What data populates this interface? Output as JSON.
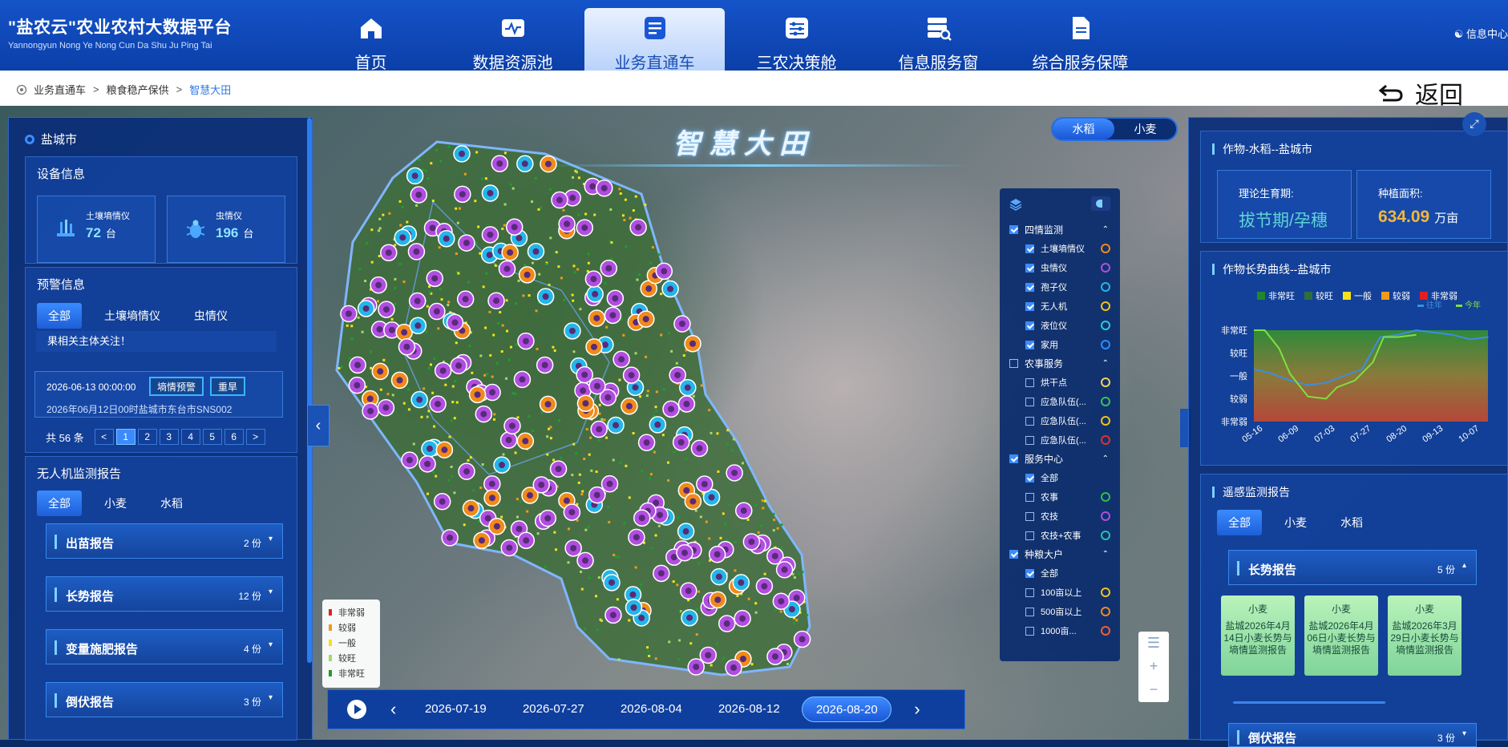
{
  "app": {
    "title": "\"盐农云\"农业农村大数据平台",
    "subtitle": "Yannongyun Nong Ye Nong Cun Da Shu Ju Ping Tai",
    "user_link": "信息中心"
  },
  "nav": [
    {
      "label": "首页",
      "icon": "home-icon",
      "active": false
    },
    {
      "label": "数据资源池",
      "icon": "pulse-chart-icon",
      "active": false
    },
    {
      "label": "业务直通车",
      "icon": "document-list-icon",
      "active": true
    },
    {
      "label": "三农决策舱",
      "icon": "sliders-icon",
      "active": false
    },
    {
      "label": "信息服务窗",
      "icon": "server-search-icon",
      "active": false
    },
    {
      "label": "综合服务保障",
      "icon": "file-icon",
      "active": false
    }
  ],
  "breadcrumb": [
    "业务直通车",
    "粮食稳产保供",
    "智慧大田"
  ],
  "back_label": "返回",
  "map": {
    "title": "智慧大田",
    "crop_toggle": [
      "水稻",
      "小麦"
    ],
    "legend": [
      {
        "label": "非常弱",
        "color": "#e02020"
      },
      {
        "label": "较弱",
        "color": "#f09a1c"
      },
      {
        "label": "一般",
        "color": "#f5e21a"
      },
      {
        "label": "较旺",
        "color": "#a7d86a"
      },
      {
        "label": "非常旺",
        "color": "#1e9e2c"
      }
    ],
    "timeline": [
      "2026-07-19",
      "2026-07-27",
      "2026-08-04",
      "2026-08-12",
      "2026-08-20"
    ],
    "timeline_active": 4
  },
  "left": {
    "city": "盐城市",
    "device_title": "设备信息",
    "devices": [
      {
        "name": "土壤墒情仪",
        "count": "72",
        "unit": "台",
        "icon": "soil-sensor-icon"
      },
      {
        "name": "虫情仪",
        "count": "196",
        "unit": "台",
        "icon": "bug-icon"
      }
    ],
    "warning_title": "预警信息",
    "warning_tabs": [
      "全部",
      "土壤墒情仪",
      "虫情仪"
    ],
    "warning_text": "果相关主体关注！",
    "warning_item": {
      "time": "2026-06-13 00:00:00",
      "tag1": "墒情预警",
      "tag2": "重旱",
      "sub": "2026年06月12日00时盐城市东台市SNS002"
    },
    "pager": {
      "total_label": "共 56 条",
      "pages": [
        "1",
        "2",
        "3",
        "4",
        "5",
        "6"
      ],
      "current": "1"
    },
    "drone_title": "无人机监测报告",
    "drone_tabs": [
      "全部",
      "小麦",
      "水稻"
    ],
    "reports": [
      {
        "title": "出苗报告",
        "count": "2 份"
      },
      {
        "title": "长势报告",
        "count": "12 份"
      },
      {
        "title": "变量施肥报告",
        "count": "4 份"
      },
      {
        "title": "倒伏报告",
        "count": "3 份"
      }
    ]
  },
  "layers": {
    "groups": [
      {
        "label": "四情监测",
        "checked": true,
        "items": [
          {
            "label": "土壤墒情仪",
            "checked": true,
            "color": "#f08a1a"
          },
          {
            "label": "虫情仪",
            "checked": true,
            "color": "#b04ee0"
          },
          {
            "label": "孢子仪",
            "checked": true,
            "color": "#23b6e8"
          },
          {
            "label": "无人机",
            "checked": true,
            "color": "#f0c21a"
          },
          {
            "label": "液位仪",
            "checked": true,
            "color": "#23d0d8"
          },
          {
            "label": "家用",
            "checked": true,
            "color": "#2d8cff"
          }
        ]
      },
      {
        "label": "农事服务",
        "checked": false,
        "items": [
          {
            "label": "烘干点",
            "checked": false,
            "color": "#f0d060"
          },
          {
            "label": "应急队伍(...",
            "checked": false,
            "color": "#3cc05a"
          },
          {
            "label": "应急队伍(...",
            "checked": false,
            "color": "#f0c21a"
          },
          {
            "label": "应急队伍(...",
            "checked": false,
            "color": "#e03030"
          }
        ]
      },
      {
        "label": "服务中心",
        "checked": true,
        "items": [
          {
            "label": "全部",
            "checked": true,
            "color": ""
          },
          {
            "label": "农事",
            "checked": false,
            "color": "#2bbf4a"
          },
          {
            "label": "农技",
            "checked": false,
            "color": "#b04ee0"
          },
          {
            "label": "农技+农事",
            "checked": false,
            "color": "#23c0b0"
          }
        ]
      },
      {
        "label": "种粮大户",
        "checked": true,
        "items": [
          {
            "label": "全部",
            "checked": true,
            "color": ""
          },
          {
            "label": "100亩以上",
            "checked": false,
            "color": "#f0c21a"
          },
          {
            "label": "500亩以上",
            "checked": false,
            "color": "#f08a1a"
          },
          {
            "label": "1000亩...",
            "checked": false,
            "color": "#f06030"
          }
        ]
      }
    ]
  },
  "right": {
    "crop_title": "作物-水稻--盐城市",
    "stage_label": "理论生育期:",
    "stage_value": "拔节期/孕穗",
    "area_label": "种植面积:",
    "area_value": "634.09",
    "area_unit": "万亩",
    "curve_title": "作物长势曲线--盐城市",
    "remote_title": "遥感监测报告",
    "remote_tabs": [
      "全部",
      "小麦",
      "水稻"
    ],
    "growth_report": {
      "title": "长势报告",
      "count": "5 份"
    },
    "cards": [
      {
        "crop": "小麦",
        "text": "盐城2026年4月14日小麦长势与墒情监测报告"
      },
      {
        "crop": "小麦",
        "text": "盐城2026年4月06日小麦长势与墒情监测报告"
      },
      {
        "crop": "小麦",
        "text": "盐城2026年3月29日小麦长势与墒情监测报告"
      }
    ],
    "lodging_report": {
      "title": "倒伏报告",
      "count": "3 份"
    }
  },
  "chart_data": {
    "type": "line",
    "title": "",
    "legend": [
      {
        "name": "非常旺",
        "color": "#1e8a2c"
      },
      {
        "name": "较旺",
        "color": "#2f6e3a"
      },
      {
        "name": "一般",
        "color": "#f5e21a"
      },
      {
        "name": "较弱",
        "color": "#f09a1c"
      },
      {
        "name": "非常弱",
        "color": "#e02020"
      }
    ],
    "y_categories": [
      "非常弱",
      "较弱",
      "一般",
      "较旺",
      "非常旺"
    ],
    "ylim": [
      0,
      4
    ],
    "x_ticks": [
      "05-16",
      "06-09",
      "07-03",
      "07-27",
      "08-20",
      "09-13",
      "10-07"
    ],
    "x_range": [
      0,
      6
    ],
    "series": [
      {
        "name": "往年",
        "color": "#3a8fe0",
        "x": [
          0,
          0.5,
          1,
          1.5,
          2,
          2.5,
          3,
          3.5,
          4,
          4.5,
          5,
          5.5,
          6,
          6.5
        ],
        "y": [
          2.3,
          2.1,
          1.8,
          1.6,
          1.7,
          2.0,
          2.3,
          3.7,
          3.8,
          4.0,
          3.9,
          3.8,
          3.6,
          3.7
        ]
      },
      {
        "name": "今年",
        "color": "#7ee040",
        "x": [
          0,
          0.3,
          0.7,
          1,
          1.5,
          2,
          2.3,
          2.8,
          3.3,
          3.6,
          4,
          4.5
        ],
        "y": [
          4.0,
          4.0,
          3.2,
          2.1,
          1.1,
          1.0,
          1.5,
          1.8,
          2.6,
          3.7,
          3.7,
          3.8
        ]
      }
    ]
  }
}
